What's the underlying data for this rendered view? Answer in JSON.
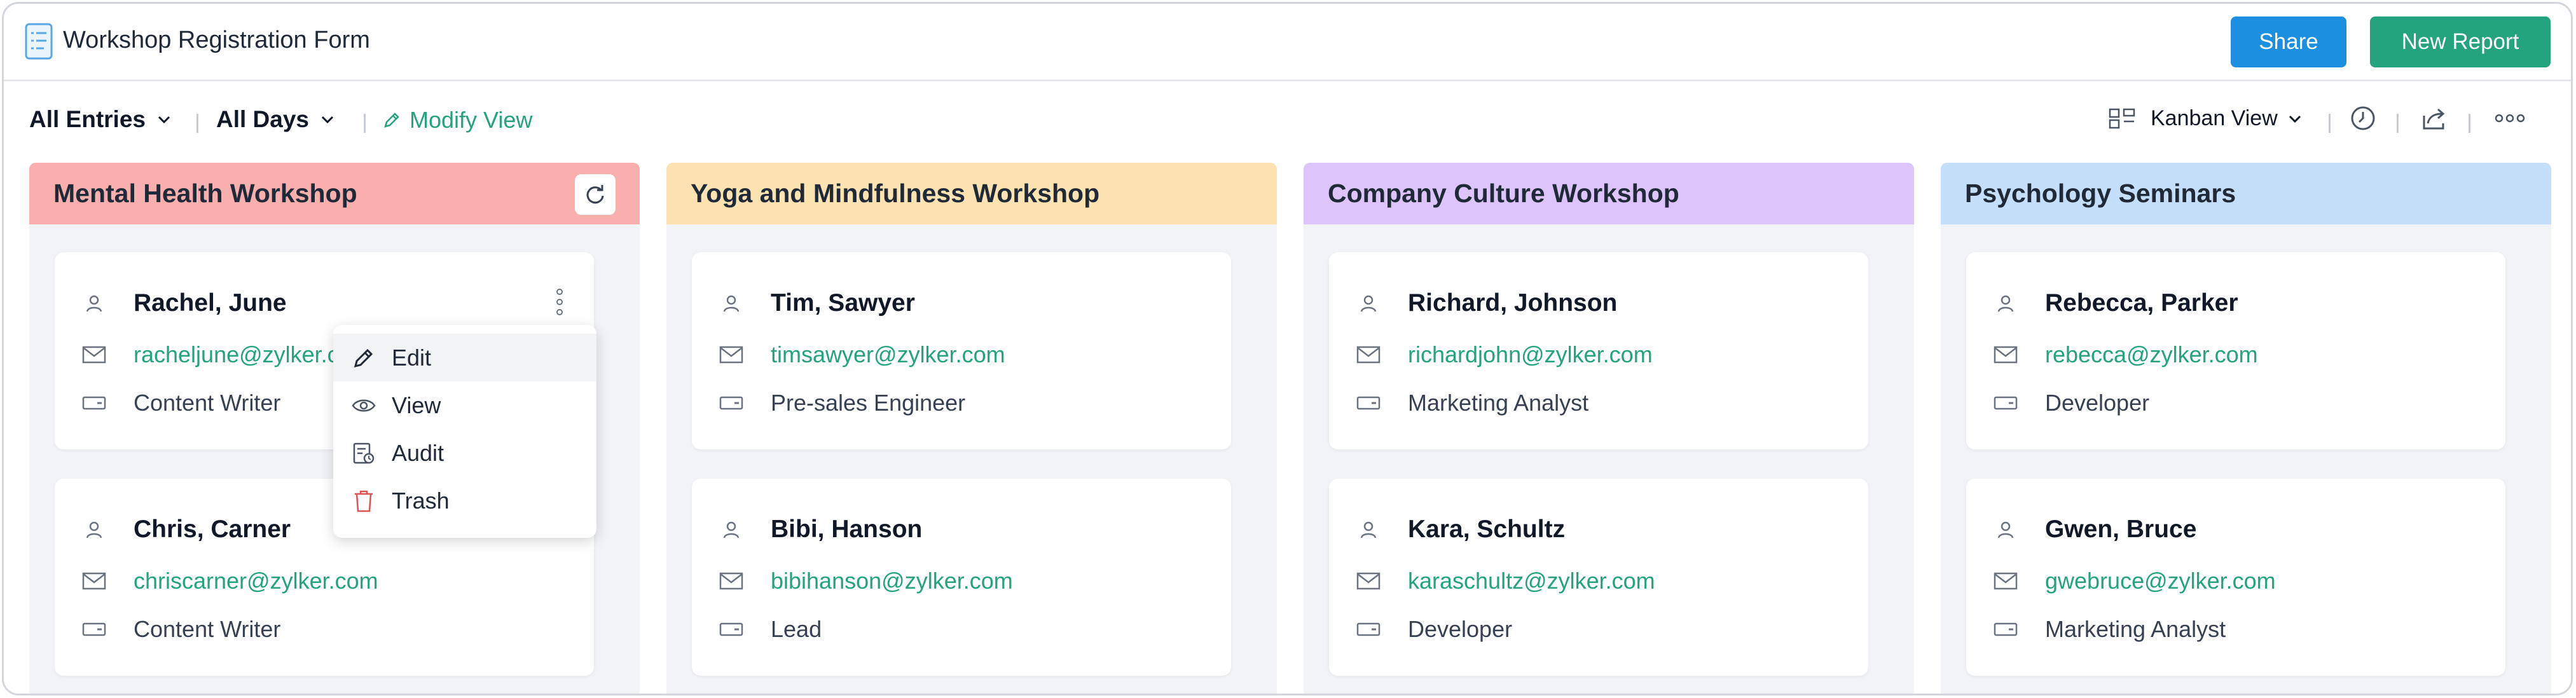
{
  "header": {
    "title": "Workshop Registration Form",
    "share_label": "Share",
    "new_report_label": "New Report"
  },
  "toolbar": {
    "entries_filter": "All Entries",
    "days_filter": "All Days",
    "modify_view": "Modify View",
    "view_mode": "Kanban View"
  },
  "colors": {
    "accent_green": "#24a37f",
    "share_blue": "#1d8fe1",
    "col_mental": "#f8afae",
    "col_yoga": "#fde3b1",
    "col_culture": "#ddc5fb",
    "col_psych": "#c5def9",
    "trash_red": "#e05252"
  },
  "columns": [
    {
      "title": "Mental Health Workshop",
      "cards": [
        {
          "name": "Rachel, June",
          "email": "racheljune@zylker.com",
          "role": "Content Writer"
        },
        {
          "name": "Chris, Carner",
          "email": "chriscarner@zylker.com",
          "role": "Content Writer"
        }
      ]
    },
    {
      "title": "Yoga and Mindfulness Workshop",
      "cards": [
        {
          "name": "Tim, Sawyer",
          "email": "timsawyer@zylker.com",
          "role": "Pre-sales Engineer"
        },
        {
          "name": "Bibi, Hanson",
          "email": "bibihanson@zylker.com",
          "role": "Lead"
        }
      ]
    },
    {
      "title": "Company Culture Workshop",
      "cards": [
        {
          "name": "Richard, Johnson",
          "email": "richardjohn@zylker.com",
          "role": "Marketing Analyst"
        },
        {
          "name": "Kara, Schultz",
          "email": "karaschultz@zylker.com",
          "role": "Developer"
        }
      ]
    },
    {
      "title": "Psychology Seminars",
      "cards": [
        {
          "name": "Rebecca, Parker",
          "email": "rebecca@zylker.com",
          "role": "Developer"
        },
        {
          "name": "Gwen, Bruce",
          "email": "gwebruce@zylker.com",
          "role": "Marketing Analyst"
        }
      ]
    }
  ],
  "context_menu": {
    "items": [
      {
        "label": "Edit",
        "icon": "pencil-icon"
      },
      {
        "label": "View",
        "icon": "eye-icon"
      },
      {
        "label": "Audit",
        "icon": "audit-icon"
      },
      {
        "label": "Trash",
        "icon": "trash-icon"
      }
    ]
  }
}
